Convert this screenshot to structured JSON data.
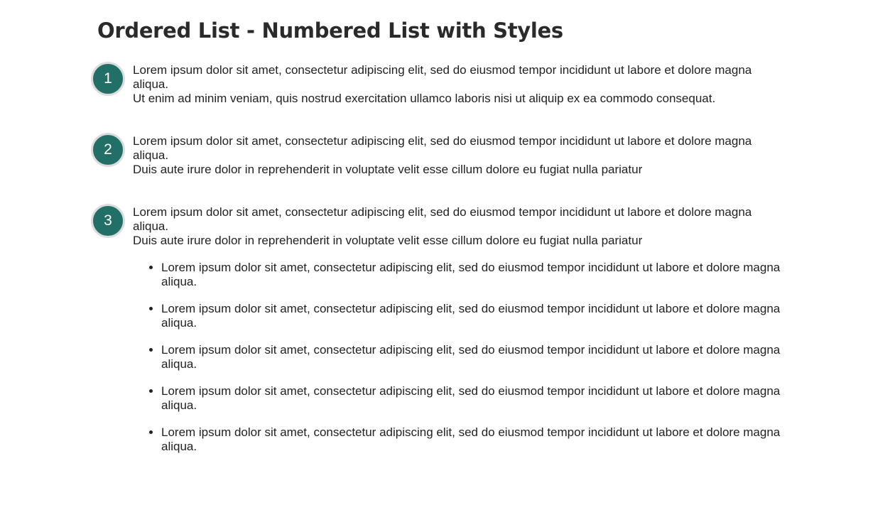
{
  "title": "Ordered List - Numbered List with Styles",
  "accent": "#226f68",
  "items": [
    {
      "number": "1",
      "text": "Lorem ipsum dolor sit amet, consectetur adipiscing elit, sed do eiusmod tempor incididunt ut labore et dolore magna aliqua.",
      "text2": "Ut enim ad minim veniam, quis nostrud exercitation ullamco laboris nisi ut aliquip ex ea commodo consequat."
    },
    {
      "number": "2",
      "text": "Lorem ipsum dolor sit amet, consectetur adipiscing elit, sed do eiusmod tempor incididunt ut labore et dolore magna aliqua.",
      "text2": "Duis aute irure dolor in reprehenderit in voluptate velit esse cillum dolore eu fugiat nulla pariatur"
    },
    {
      "number": "3",
      "text": "Lorem ipsum dolor sit amet, consectetur adipiscing elit, sed do eiusmod tempor incididunt ut labore et dolore magna aliqua.",
      "text2": "Duis aute irure dolor in reprehenderit in voluptate velit esse cillum dolore eu fugiat nulla pariatur",
      "subitems": [
        "Lorem ipsum dolor sit amet, consectetur adipiscing elit, sed do eiusmod tempor incididunt ut labore et dolore magna aliqua.",
        "Lorem ipsum dolor sit amet, consectetur adipiscing elit, sed do eiusmod tempor incididunt ut labore et dolore magna aliqua.",
        "Lorem ipsum dolor sit amet, consectetur adipiscing elit, sed do eiusmod tempor incididunt ut labore et dolore magna aliqua.",
        "Lorem ipsum dolor sit amet, consectetur adipiscing elit, sed do eiusmod tempor incididunt ut labore et dolore magna aliqua.",
        "Lorem ipsum dolor sit amet, consectetur adipiscing elit, sed do eiusmod tempor incididunt ut labore et dolore magna aliqua."
      ]
    }
  ]
}
